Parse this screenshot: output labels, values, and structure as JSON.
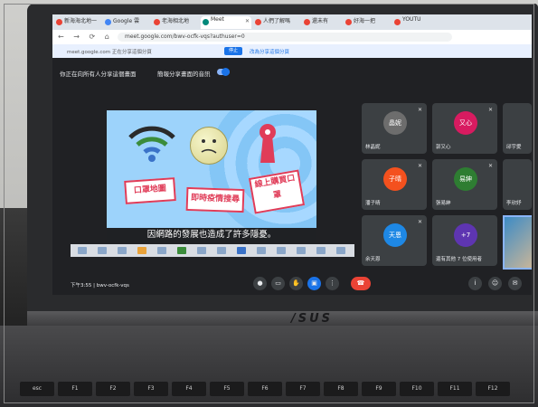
{
  "browser": {
    "tabs": [
      {
        "label": "新海海北地一",
        "color": "#ea4335"
      },
      {
        "label": "Google 雲",
        "color": "#4285f4"
      },
      {
        "label": "老海相北地",
        "color": "#ea4335"
      },
      {
        "label": "Meet",
        "color": "#00897b"
      },
      {
        "label": "人們了解嗎",
        "color": "#ea4335"
      },
      {
        "label": "還未有",
        "color": "#ea4335"
      },
      {
        "label": "好海一把",
        "color": "#ea4335"
      },
      {
        "label": "YOUTU",
        "color": "#ea4335"
      }
    ],
    "address": "meet.google.com/bwv-ocfk-vqs?authuser=0",
    "share_url": "meet.google.com 正在分享這個分頁",
    "stop_label": "停止",
    "hide_label": "改為分享這個分頁"
  },
  "meet": {
    "top_note": "你正在向所有人分享這個畫面",
    "toggle_label": "簡報分享畫面的音訊",
    "slide_signs": [
      "口罩地圖",
      "即時疫情搜尋",
      "線上購買口罩"
    ],
    "caption": "因網路的發展也造成了許多隱憂。",
    "participants": [
      {
        "name": "林晶妮",
        "avatar": "晶妮",
        "color": "#6d6d6d"
      },
      {
        "name": "郭又心",
        "avatar": "又心",
        "color": "#d81b60"
      },
      {
        "name": "潘子晴",
        "avatar": "子晴",
        "color": "#f4511e"
      },
      {
        "name": "張易紳",
        "avatar": "易紳",
        "color": "#2e7d32"
      },
      {
        "name": "余天恩",
        "avatar": "天恩",
        "color": "#1e88e5"
      },
      {
        "name": "還有其他 7 位使用者",
        "avatar": "+7",
        "color": "#5e35b1"
      },
      {
        "name": "邱宇愛",
        "avatar": "",
        "color": "#3c4043"
      },
      {
        "name": "李欣妤",
        "avatar": "",
        "color": "#3c4043"
      }
    ],
    "meeting_code": "下午3:55 | bwv-ocfk-vqs",
    "controls": [
      "mic",
      "camera",
      "hand",
      "present",
      "more"
    ]
  },
  "laptop": {
    "brand": "/SUS"
  },
  "keys": [
    "esc",
    "F1",
    "F2",
    "F3",
    "F4",
    "F5",
    "F6",
    "F7",
    "F8",
    "F9",
    "F10",
    "F11",
    "F12"
  ]
}
